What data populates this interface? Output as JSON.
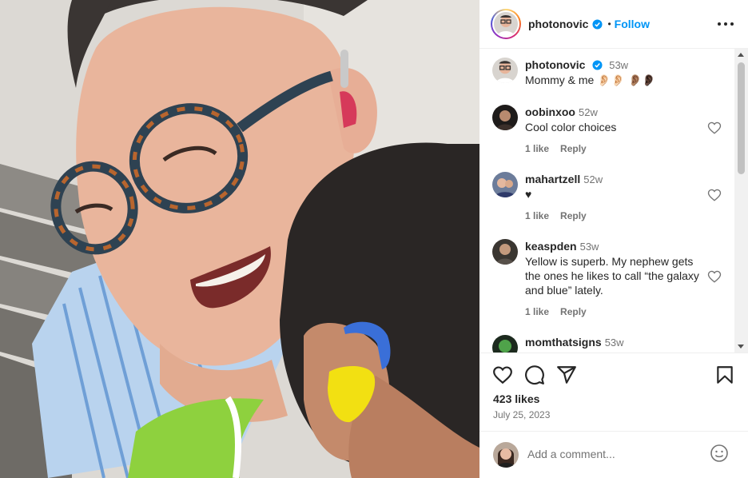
{
  "post": {
    "author": "photonovic",
    "follow_label": "Follow",
    "separator": "•",
    "caption_time": "53w",
    "caption": "Mommy & me 👂🏻👂🏻 👂🏽👂🏿",
    "likes": "423 likes",
    "date": "July 25, 2023"
  },
  "comments": [
    {
      "user": "oobinxoo",
      "time": "52w",
      "text": "Cool color choices",
      "likes": "1 like",
      "reply": "Reply"
    },
    {
      "user": "mahartzell",
      "time": "52w",
      "text": "♥",
      "likes": "1 like",
      "reply": "Reply"
    },
    {
      "user": "keaspden",
      "time": "53w",
      "text": "Yellow is superb. My nephew gets the ones he likes to call “the galaxy and blue” lately.",
      "likes": "1 like",
      "reply": "Reply"
    },
    {
      "user": "momthatsigns",
      "time": "53w",
      "text": ""
    }
  ],
  "composer": {
    "placeholder": "Add a comment..."
  },
  "colors": {
    "link_blue": "#0095f6",
    "verified_blue": "#0095f6",
    "muted_text": "#737373"
  },
  "icons": [
    "more-options-icon",
    "verified-badge-icon",
    "heart-icon",
    "comment-icon",
    "share-icon",
    "bookmark-icon",
    "emoji-icon"
  ]
}
